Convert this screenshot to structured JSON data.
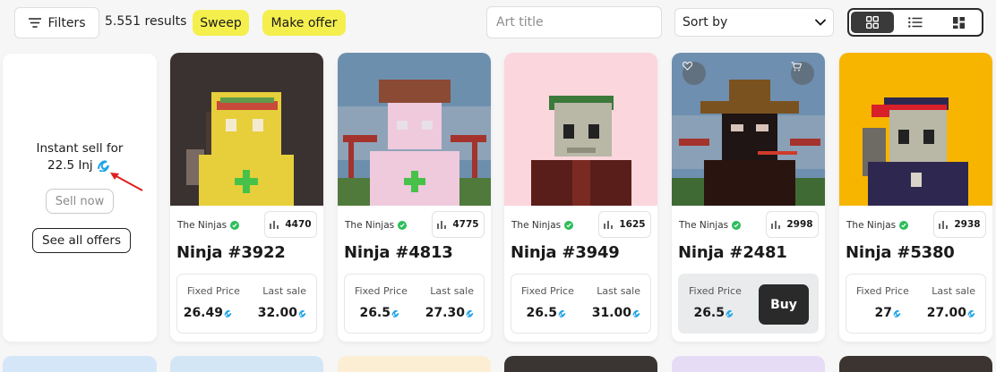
{
  "toolbar": {
    "filters_label": "Filters",
    "results_count": "5.551 results",
    "sweep_label": "Sweep",
    "make_offer_label": "Make offer",
    "search_placeholder": "Art title",
    "sort_label": "Sort by",
    "view_modes": [
      "grid-icon",
      "list-icon",
      "mosaic-icon"
    ],
    "active_view": "grid-icon",
    "accent_yellow": "#f5ef4e"
  },
  "left_panel": {
    "instant_sell_line1": "Instant sell for",
    "instant_sell_amount": "22.5 Inj",
    "sell_now_label": "Sell now",
    "see_all_offers_label": "See all offers"
  },
  "cards": [
    {
      "collection": "The Ninjas",
      "rank": "4470",
      "name": "Ninja #3922",
      "fixed_label": "Fixed Price",
      "last_label": "Last sale",
      "fixed_price": "26.49",
      "last_sale": "32.00",
      "bg": "#3a3230",
      "highlight": false
    },
    {
      "collection": "The Ninjas",
      "rank": "4775",
      "name": "Ninja #4813",
      "fixed_label": "Fixed Price",
      "last_label": "Last sale",
      "fixed_price": "26.5",
      "last_sale": "27.30",
      "bg": "#6d8fae",
      "highlight": false
    },
    {
      "collection": "The Ninjas",
      "rank": "1625",
      "name": "Ninja #3949",
      "fixed_label": "Fixed Price",
      "last_label": "Last sale",
      "fixed_price": "26.5",
      "last_sale": "31.00",
      "bg": "#fbd6dd",
      "highlight": false
    },
    {
      "collection": "The Ninjas",
      "rank": "2998",
      "name": "Ninja #2481",
      "fixed_label": "Fixed Price",
      "last_label": "",
      "fixed_price": "26.5",
      "last_sale": "",
      "bg": "#6e8fb0",
      "highlight": true,
      "buy_label": "Buy"
    },
    {
      "collection": "The Ninjas",
      "rank": "2938",
      "name": "Ninja #5380",
      "fixed_label": "Fixed Price",
      "last_label": "Last sale",
      "fixed_price": "27",
      "last_sale": "27.00",
      "bg": "#f7b500",
      "highlight": false
    }
  ],
  "colors": {
    "verified_green": "#2ebd5a",
    "inj_blue": "#22a4e8",
    "buy_button": "#2a2a2a"
  }
}
